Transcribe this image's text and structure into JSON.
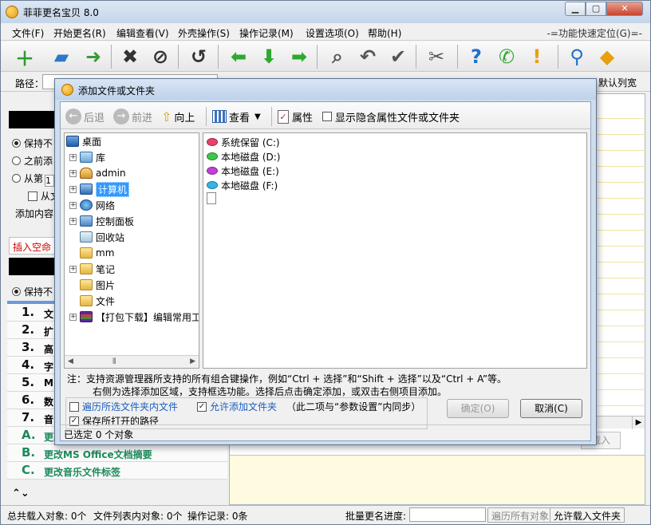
{
  "window": {
    "title": "菲菲更名宝贝 8.0",
    "min": "▁",
    "max": "▢",
    "close": "✕"
  },
  "menu": {
    "items": [
      "文件(F)",
      "开始更名(R)",
      "编辑查看(V)",
      "外壳操作(S)",
      "操作记录(M)",
      "设置选项(O)",
      "帮助(H)"
    ],
    "quick_locate": "-=功能快速定位(G)=-"
  },
  "toolbar": {
    "icons": [
      "add-file-icon",
      "add-folder-icon",
      "import-icon",
      "delete-icon",
      "stop-icon",
      "refresh-icon",
      "left-arrow-icon",
      "down-arrow-icon",
      "right-arrow-icon",
      "search-icon",
      "undo-icon",
      "check-icon",
      "tools-icon",
      "help-icon",
      "phone-icon",
      "warning-icon",
      "pin-icon",
      "exit-icon"
    ]
  },
  "pathbar": {
    "label": "路径：",
    "default_cols": "默认列宽"
  },
  "left_panel": {
    "keep1": "保持不",
    "before_add": "之前添",
    "from_nth": "从第",
    "from_nth_value": "1",
    "from_sub": "从文",
    "add_content": "添加内容",
    "insert_space": "插入空命",
    "keep2": "保持不",
    "steps": [
      {
        "num": "1.",
        "label": "文"
      },
      {
        "num": "2.",
        "label": "扩"
      },
      {
        "num": "3.",
        "label": "高"
      },
      {
        "num": "4.",
        "label": "字"
      },
      {
        "num": "5.",
        "label": "M"
      },
      {
        "num": "6.",
        "label": "数"
      },
      {
        "num": "7.",
        "label": "音"
      },
      {
        "num": "A.",
        "label": "更改"
      },
      {
        "num": "B.",
        "label": "更改MS Office文档摘要"
      },
      {
        "num": "C.",
        "label": "更改音乐文件标签"
      }
    ]
  },
  "right_panel": {
    "add_btn": "载入"
  },
  "statusbar": {
    "total": "总共载入对象: 0个",
    "file_list": "文件列表内对象: 0个",
    "ops": "操作记录: 0条",
    "progress_label": "批量更名进度:",
    "traverse": "遍历所有对象",
    "allow_folder": "允许载入文件夹"
  },
  "dialog": {
    "title": "添加文件或文件夹",
    "toolbar": {
      "back": "后退",
      "forward": "前进",
      "up": "向上",
      "view": "查看",
      "properties": "属性",
      "show_hidden": "显示隐含属性文件或文件夹"
    },
    "tree": [
      {
        "label": "桌面",
        "icon": "desktop-icon"
      },
      {
        "label": "库",
        "icon": "library-icon"
      },
      {
        "label": "admin",
        "icon": "user-icon"
      },
      {
        "label": "计算机",
        "icon": "computer-icon"
      },
      {
        "label": "网络",
        "icon": "network-icon"
      },
      {
        "label": "控制面板",
        "icon": "control-panel-icon"
      },
      {
        "label": "回收站",
        "icon": "recycle-bin-icon"
      },
      {
        "label": "mm",
        "icon": "folder-icon"
      },
      {
        "label": "笔记",
        "icon": "folder-icon"
      },
      {
        "label": "图片",
        "icon": "folder-icon"
      },
      {
        "label": "文件",
        "icon": "folder-icon"
      },
      {
        "label": "【打包下载】编辑常用工",
        "icon": "archive-icon"
      }
    ],
    "drives": [
      {
        "label": "系统保留 (C:)",
        "color": "#e8406a"
      },
      {
        "label": "本地磁盘 (D:)",
        "color": "#3cc84a"
      },
      {
        "label": "本地磁盘 (E:)",
        "color": "#c040d8"
      },
      {
        "label": "本地磁盘 (F:)",
        "color": "#34b4e8"
      }
    ],
    "note1": "注：支持资源管理器所支持的所有组合键操作，例如“Ctrl + 选择”和“Shift + 选择”以及“Ctrl + A”等。",
    "note2": "右侧为选择添加区域，支持框选功能。选择后点击确定添加，或双击右侧项目添加。",
    "opt_traverse": "遍历所选文件夹内文件",
    "opt_allow_folder": "允许添加文件夹",
    "opt_sync_note": "（此二项与“参数设置”内同步）",
    "opt_save_path": "保存所打开的路径",
    "ok": "确定(O)",
    "cancel": "取消(C)",
    "status": "已选定 0 个对象"
  },
  "colors": {
    "accent": "#3399ff",
    "title_bar": "#c4d5ea",
    "step_highlight": "#1b8a5a",
    "warning_text": "#cc0000"
  }
}
